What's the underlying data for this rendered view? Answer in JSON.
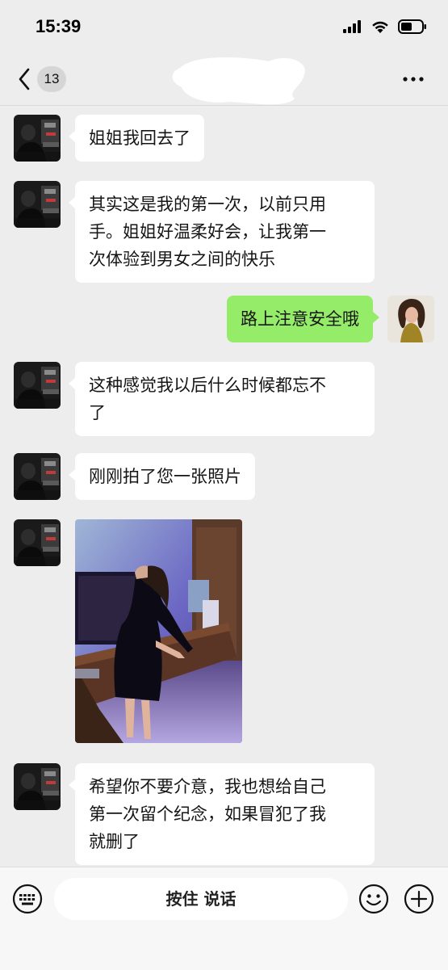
{
  "status_bar": {
    "time": "15:39"
  },
  "nav": {
    "unread_count": "13"
  },
  "messages": [
    {
      "side": "left",
      "type": "text",
      "text": "姐姐我回去了"
    },
    {
      "side": "left",
      "type": "text",
      "text": "其实这是我的第一次，以前只用\n手。姐姐好温柔好会，让我第一\n次体验到男女之间的快乐"
    },
    {
      "side": "right",
      "type": "text",
      "text": "路上注意安全哦"
    },
    {
      "side": "left",
      "type": "text",
      "text": "这种感觉我以后什么时候都忘不\n了"
    },
    {
      "side": "left",
      "type": "text",
      "text": "刚刚拍了您一张照片"
    },
    {
      "side": "left",
      "type": "image"
    },
    {
      "side": "left",
      "type": "text",
      "text": "希望你不要介意，我也想给自己\n第一次留个纪念，如果冒犯了我\n就删了"
    }
  ],
  "input_bar": {
    "voice_button_label": "按住 说话"
  },
  "colors": {
    "background": "#ededed",
    "sent_bubble": "#95ec69",
    "received_bubble": "#ffffff"
  }
}
